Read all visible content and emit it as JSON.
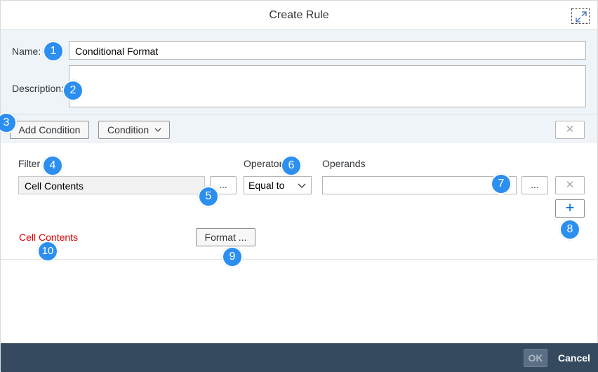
{
  "dialog": {
    "title": "Create Rule"
  },
  "form": {
    "name_label": "Name:",
    "name_value": "Conditional Format",
    "description_label": "Description:",
    "description_value": ""
  },
  "toolbar": {
    "add_condition_label": "Add Condition",
    "condition_dropdown_label": "Condition",
    "remove_label": "✕"
  },
  "condition": {
    "filter_label": "Filter",
    "filter_value": "Cell Contents",
    "filter_more_label": "...",
    "operator_label": "Operator",
    "operator_value": "Equal to",
    "operands_label": "Operands",
    "operands_value": "",
    "operands_more_label": "...",
    "remove_label": "✕",
    "add_label": "+",
    "preview_text": "Cell Contents",
    "format_button_label": "Format ..."
  },
  "footer": {
    "ok_label": "OK",
    "cancel_label": "Cancel"
  },
  "markers": [
    "1",
    "2",
    "3",
    "4",
    "5",
    "6",
    "7",
    "8",
    "9",
    "10"
  ],
  "icons": {
    "expand": "expand-icon",
    "chevron": "chevron-down-icon"
  },
  "colors": {
    "accent_marker": "#2c8ff0",
    "preview_text": "#e00000",
    "footer_bg": "#354a5f",
    "section_bg": "#eff4f9"
  }
}
